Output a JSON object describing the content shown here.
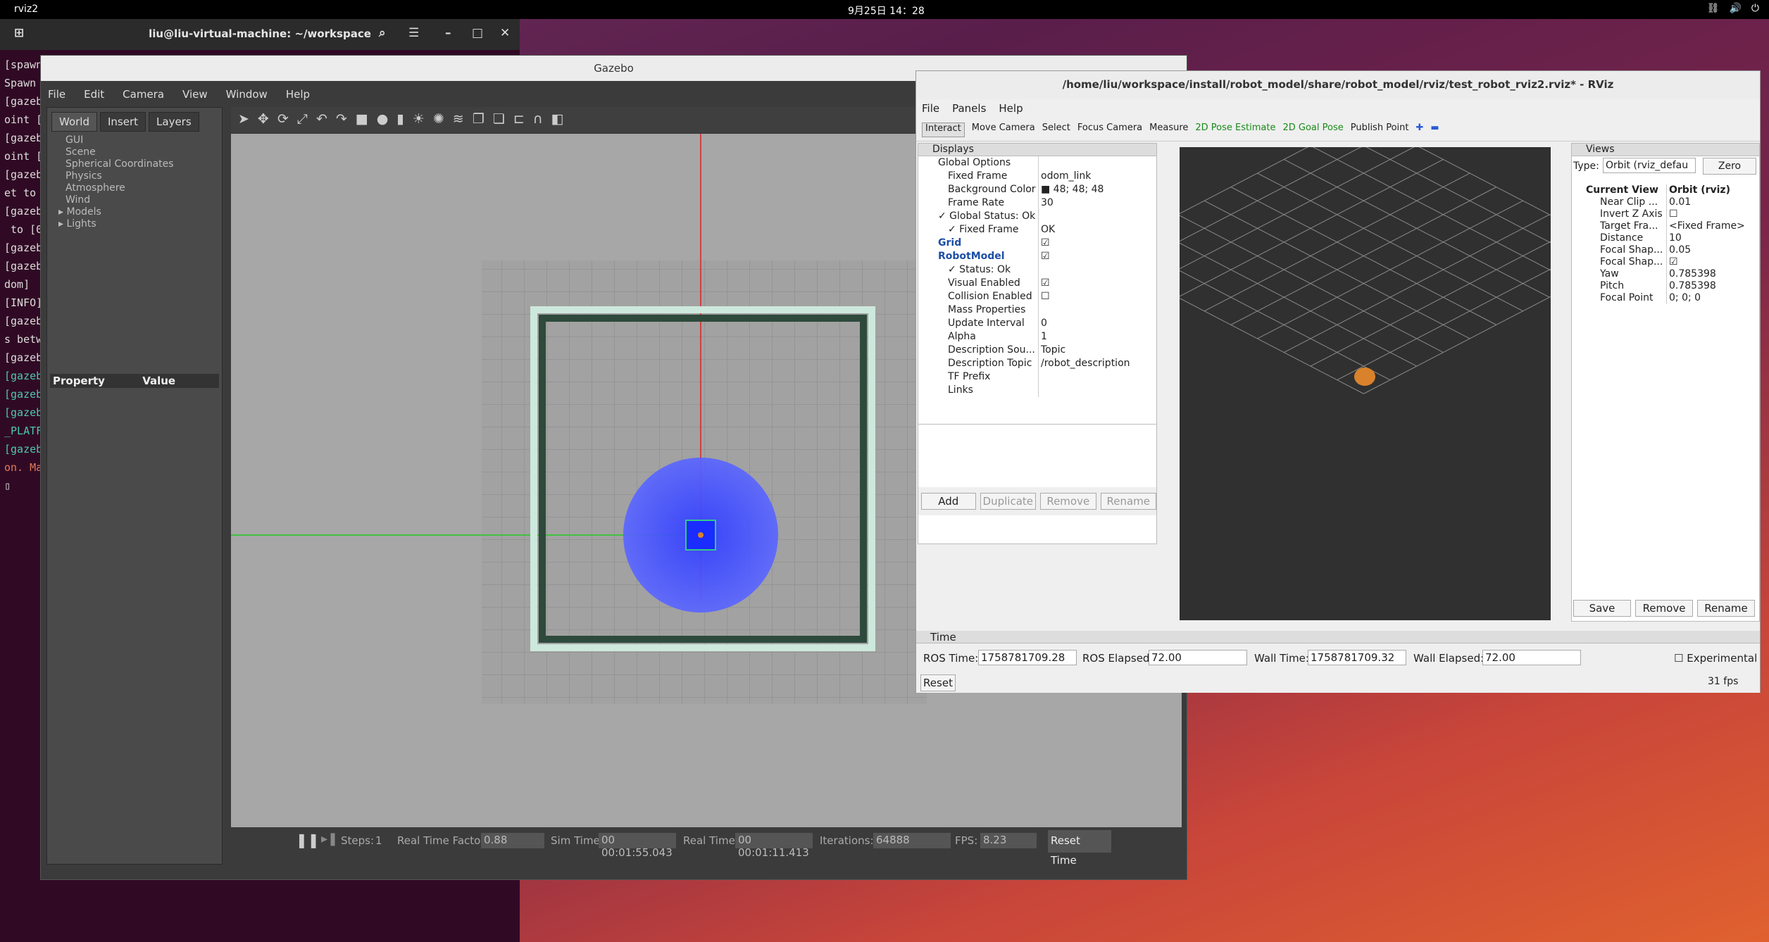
{
  "topbar": {
    "activity": "rviz2",
    "clock": "9月25日 14：28"
  },
  "terminal": {
    "title": "liu@liu-virtual-machine: ~/workspace",
    "lines": [
      {
        "t": "[spawn",
        "c": ""
      },
      {
        "t": "Spawn",
        "c": ""
      },
      {
        "t": "[gazeb",
        "c": ""
      },
      {
        "t": "oint [",
        "c": ""
      },
      {
        "t": "[gazeb",
        "c": ""
      },
      {
        "t": "oint [",
        "c": ""
      },
      {
        "t": "[gazeb",
        "c": ""
      },
      {
        "t": "et to",
        "c": ""
      },
      {
        "t": "[gazeb",
        "c": ""
      },
      {
        "t": " to [0",
        "c": ""
      },
      {
        "t": "[gazeb",
        "c": ""
      },
      {
        "t": "[gazeb",
        "c": ""
      },
      {
        "t": "dom]",
        "c": ""
      },
      {
        "t": "[INFO]",
        "c": ""
      },
      {
        "t": "[gazeb",
        "c": ""
      },
      {
        "t": "s betw",
        "c": ""
      },
      {
        "t": "[gazeb",
        "c": ""
      },
      {
        "t": "[gazeb",
        "c": "g"
      },
      {
        "t": "[gazeb",
        "c": "g"
      },
      {
        "t": "[gazeb",
        "c": "g"
      },
      {
        "t": "_PLATF",
        "c": "g"
      },
      {
        "t": "[gazeb",
        "c": "g"
      },
      {
        "t": "on. Ma",
        "c": "o"
      }
    ]
  },
  "gazebo": {
    "title": "Gazebo",
    "menu": [
      "File",
      "Edit",
      "Camera",
      "View",
      "Window",
      "Help"
    ],
    "tabs": [
      "World",
      "Insert",
      "Layers"
    ],
    "tree": [
      "GUI",
      "Scene",
      "Spherical Coordinates",
      "Physics",
      "Atmosphere",
      "Wind",
      "Models",
      "Lights"
    ],
    "prop_header": {
      "property": "Property",
      "value": "Value"
    },
    "status": {
      "steps_label": "Steps:",
      "steps": "1",
      "rtf_label": "Real Time Factor:",
      "rtf": "0.88",
      "sim_label": "Sim Time:",
      "sim": "00 00:01:55.043",
      "real_label": "Real Time:",
      "real": "00 00:01:11.413",
      "iter_label": "Iterations:",
      "iter": "64888",
      "fps_label": "FPS:",
      "fps": "8.23",
      "reset": "Reset Time"
    }
  },
  "rviz": {
    "title": "/home/liu/workspace/install/robot_model/share/robot_model/rviz/test_robot_rviz2.rviz* - RViz",
    "menu": [
      "File",
      "Panels",
      "Help"
    ],
    "tools": [
      "Interact",
      "Move Camera",
      "Select",
      "Focus Camera",
      "Measure",
      "2D Pose Estimate",
      "2D Goal Pose",
      "Publish Point"
    ],
    "displays_title": "Displays",
    "rows": [
      {
        "k": "Global Options",
        "v": "",
        "ind": 0,
        "blue": false
      },
      {
        "k": "Fixed Frame",
        "v": "odom_link",
        "ind": 1,
        "blue": false
      },
      {
        "k": "Background Color",
        "v": "■ 48; 48; 48",
        "ind": 1,
        "blue": false
      },
      {
        "k": "Frame Rate",
        "v": "30",
        "ind": 1,
        "blue": false
      },
      {
        "k": "✓ Global Status: Ok",
        "v": "",
        "ind": 0,
        "blue": false
      },
      {
        "k": "✓ Fixed Frame",
        "v": "OK",
        "ind": 1,
        "blue": false
      },
      {
        "k": "Grid",
        "v": "☑",
        "ind": 0,
        "blue": true
      },
      {
        "k": "RobotModel",
        "v": "☑",
        "ind": 0,
        "blue": true
      },
      {
        "k": "✓ Status: Ok",
        "v": "",
        "ind": 1,
        "blue": false
      },
      {
        "k": "Visual Enabled",
        "v": "☑",
        "ind": 1,
        "blue": false
      },
      {
        "k": "Collision Enabled",
        "v": "☐",
        "ind": 1,
        "blue": false
      },
      {
        "k": "Mass Properties",
        "v": "",
        "ind": 1,
        "blue": false
      },
      {
        "k": "Update Interval",
        "v": "0",
        "ind": 1,
        "blue": false
      },
      {
        "k": "Alpha",
        "v": "1",
        "ind": 1,
        "blue": false
      },
      {
        "k": "Description Sou...",
        "v": "Topic",
        "ind": 1,
        "blue": false
      },
      {
        "k": "Description Topic",
        "v": "/robot_description",
        "ind": 1,
        "blue": false
      },
      {
        "k": "TF Prefix",
        "v": "",
        "ind": 1,
        "blue": false
      },
      {
        "k": "Links",
        "v": "",
        "ind": 1,
        "blue": false
      }
    ],
    "disp_buttons": [
      "Add",
      "Duplicate",
      "Remove",
      "Rename"
    ],
    "views_title": "Views",
    "type_label": "Type:",
    "type_value": "Orbit (rviz_defau",
    "zero": "Zero",
    "vrows": [
      {
        "k": "Current View",
        "v": "Orbit (rviz)",
        "b": true
      },
      {
        "k": "Near Clip ...",
        "v": "0.01",
        "b": false
      },
      {
        "k": "Invert Z Axis",
        "v": "☐",
        "b": false
      },
      {
        "k": "Target Fra...",
        "v": "<Fixed Frame>",
        "b": false
      },
      {
        "k": "Distance",
        "v": "10",
        "b": false
      },
      {
        "k": "Focal Shap...",
        "v": "0.05",
        "b": false
      },
      {
        "k": "Focal Shap...",
        "v": "☑",
        "b": false
      },
      {
        "k": "Yaw",
        "v": "0.785398",
        "b": false
      },
      {
        "k": "Pitch",
        "v": "0.785398",
        "b": false
      },
      {
        "k": "Focal Point",
        "v": "0; 0; 0",
        "b": false
      }
    ],
    "view_buttons": [
      "Save",
      "Remove",
      "Rename"
    ],
    "time": {
      "title": "Time",
      "ros_label": "ROS Time:",
      "ros": "1758781709.28",
      "rose_label": "ROS Elapsed:",
      "rose": "72.00",
      "wall_label": "Wall Time:",
      "wall": "1758781709.32",
      "walle_label": "Wall Elapsed:",
      "walle": "72.00",
      "exp": "Experimental",
      "reset": "Reset",
      "fps": "31 fps"
    }
  }
}
